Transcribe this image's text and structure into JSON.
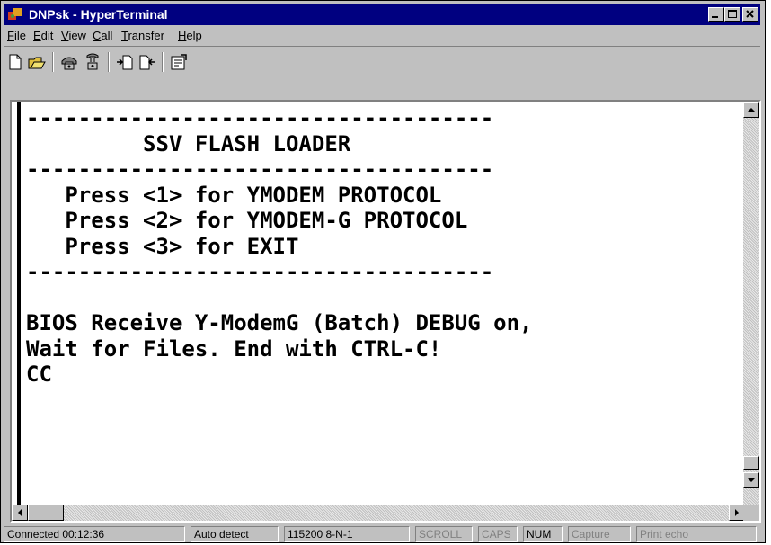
{
  "window": {
    "title": "DNPsk - HyperTerminal"
  },
  "menu": [
    {
      "mnemonic": "F",
      "rest": "ile"
    },
    {
      "mnemonic": "E",
      "rest": "dit"
    },
    {
      "mnemonic": "V",
      "rest": "iew"
    },
    {
      "mnemonic": "C",
      "rest": "all"
    },
    {
      "mnemonic": "T",
      "rest": "ransfer"
    },
    {
      "mnemonic": "H",
      "rest": "elp"
    }
  ],
  "toolbar": {
    "icons": [
      "new-icon",
      "open-icon",
      "connect-icon",
      "disconnect-icon",
      "send-icon",
      "receive-icon",
      "properties-icon"
    ]
  },
  "terminal": {
    "text": "------------------------------------\n         SSV FLASH LOADER\n------------------------------------\n   Press <1> for YMODEM PROTOCOL\n   Press <2> for YMODEM-G PROTOCOL\n   Press <3> for EXIT\n------------------------------------\n\nBIOS Receive Y-ModemG (Batch) DEBUG on,\nWait for Files. End with CTRL-C!\nCC"
  },
  "status": {
    "connected": "Connected 00:12:36",
    "detect": "Auto detect",
    "settings": "115200 8-N-1",
    "scroll": "SCROLL",
    "caps": "CAPS",
    "num": "NUM",
    "capture": "Capture",
    "print_echo": "Print echo"
  }
}
